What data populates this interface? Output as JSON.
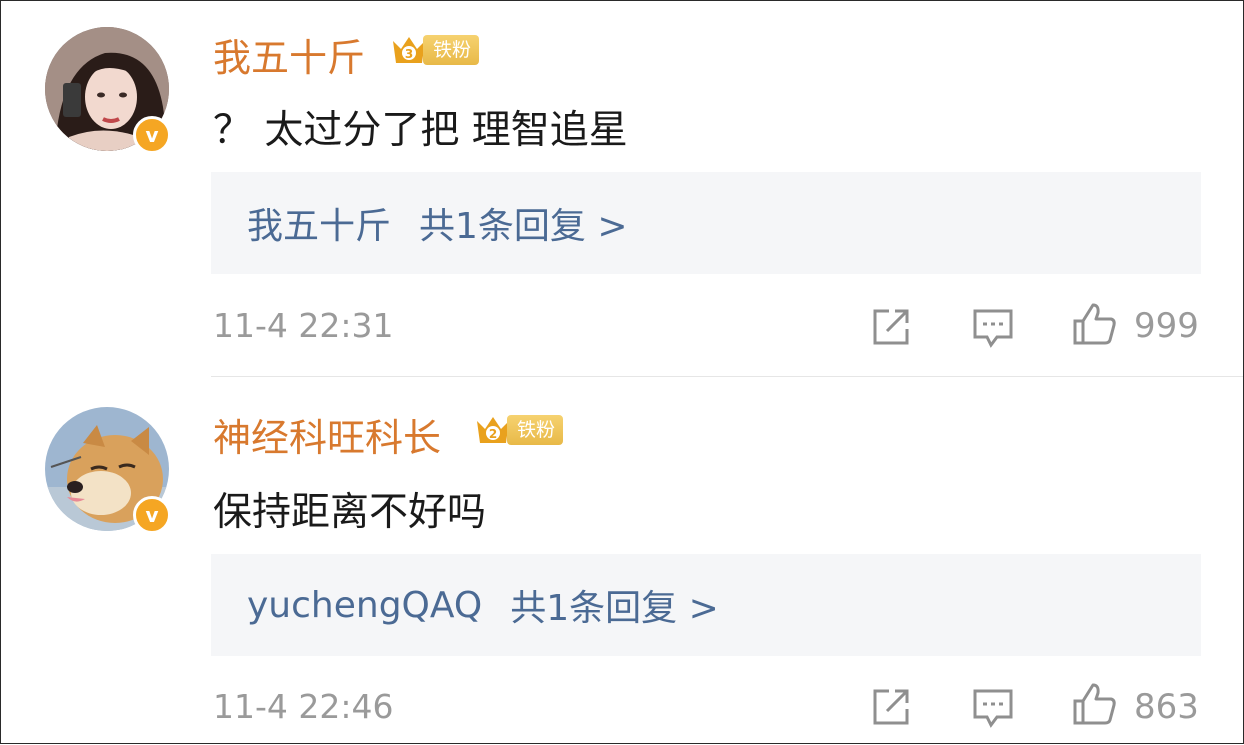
{
  "comments": [
    {
      "username": "我五十斤",
      "fan_badge": "铁粉",
      "fan_level": "3",
      "verified": "v",
      "text": "？ 太过分了把 理智追星",
      "reply_user": "我五十斤",
      "reply_count_label": "共1条回复 >",
      "timestamp": "11-4 22:31",
      "likes": "999",
      "avatar_icon": "user-avatar-girl"
    },
    {
      "username": "神经科旺科长",
      "fan_badge": "铁粉",
      "fan_level": "2",
      "verified": "v",
      "text": "保持距离不好吗",
      "reply_user": "yuchengQAQ",
      "reply_count_label": "共1条回复 >",
      "timestamp": "11-4 22:46",
      "likes": "863",
      "avatar_icon": "user-avatar-shiba"
    }
  ],
  "icons": {
    "share": "share-icon",
    "comment": "comment-icon",
    "like": "thumbs-up-icon"
  },
  "colors": {
    "username": "#d8792e",
    "reply_link": "#4b6a94",
    "badge": "#f5a623",
    "meta": "#9a9a9a"
  }
}
